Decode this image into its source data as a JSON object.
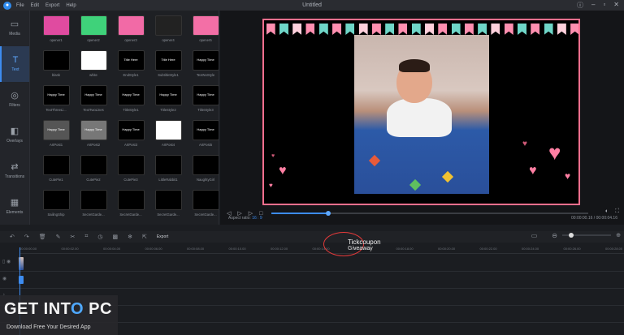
{
  "window": {
    "title": "Untitled",
    "menu": [
      "File",
      "Edit",
      "Export",
      "Help"
    ]
  },
  "sidebar": [
    {
      "label": "Media",
      "icon": "media-icon",
      "glyph": "▭",
      "active": false
    },
    {
      "label": "Text",
      "icon": "text-icon",
      "glyph": "T",
      "active": true
    },
    {
      "label": "Filters",
      "icon": "filters-icon",
      "glyph": "◎",
      "active": false
    },
    {
      "label": "Overlays",
      "icon": "overlays-icon",
      "glyph": "◧",
      "active": false
    },
    {
      "label": "Transitions",
      "icon": "transitions-icon",
      "glyph": "⇄",
      "active": false
    },
    {
      "label": "Elements",
      "icon": "elements-icon",
      "glyph": "▦",
      "active": false
    }
  ],
  "library": {
    "items": [
      {
        "label": "opener1",
        "bg": "#e04ba0",
        "text": ""
      },
      {
        "label": "opener2",
        "bg": "#3fd27a",
        "text": ""
      },
      {
        "label": "opener3",
        "bg": "#f26aa6",
        "text": ""
      },
      {
        "label": "opener4",
        "bg": "#222",
        "text": ""
      },
      {
        "label": "opener5",
        "bg": "#f36fa6",
        "text": ""
      },
      {
        "label": "blank",
        "bg": "#000",
        "text": ""
      },
      {
        "label": "white",
        "bg": "#fff",
        "text": ""
      },
      {
        "label": "EndStyle1",
        "bg": "#000",
        "text": "Title Here"
      },
      {
        "label": "SubtitleStyle1",
        "bg": "#000",
        "text": "Title Here"
      },
      {
        "label": "TextNoStyle",
        "bg": "#000",
        "text": "Happy Time"
      },
      {
        "label": "TextThreeLi...",
        "bg": "#000",
        "text": "Happy Time"
      },
      {
        "label": "TextTwoLines",
        "bg": "#000",
        "text": "Happy Time"
      },
      {
        "label": "TitleStyle1",
        "bg": "#000",
        "text": "Happy Time"
      },
      {
        "label": "TitleStyle2",
        "bg": "#000",
        "text": "Happy Time"
      },
      {
        "label": "TitleStyle3",
        "bg": "#000",
        "text": "Happy Time"
      },
      {
        "label": "ArtPost1",
        "bg": "#555",
        "text": "Happy Time"
      },
      {
        "label": "ArtPost2",
        "bg": "#777",
        "text": "Happy Time"
      },
      {
        "label": "ArtPost3",
        "bg": "#000",
        "text": "Happy Time"
      },
      {
        "label": "ArtPost4",
        "bg": "#fff",
        "text": ""
      },
      {
        "label": "ArtPost5",
        "bg": "#000",
        "text": "Happy Time"
      },
      {
        "label": "CutePie1",
        "bg": "#000",
        "text": ""
      },
      {
        "label": "CutePie2",
        "bg": "#000",
        "text": ""
      },
      {
        "label": "CutePie3",
        "bg": "#000",
        "text": ""
      },
      {
        "label": "LittleRabbit1",
        "bg": "#000",
        "text": ""
      },
      {
        "label": "NaughtyGirl",
        "bg": "#000",
        "text": ""
      },
      {
        "label": "SailingShip",
        "bg": "#000",
        "text": ""
      },
      {
        "label": "SecretGarde...",
        "bg": "#000",
        "text": ""
      },
      {
        "label": "SecretGarde...",
        "bg": "#000",
        "text": ""
      },
      {
        "label": "SecretGarde...",
        "bg": "#000",
        "text": ""
      },
      {
        "label": "SecretGarde...",
        "bg": "#000",
        "text": ""
      }
    ]
  },
  "preview": {
    "aspect_label": "Aspect ratio:",
    "aspect_value": "16 : 9",
    "timecode": "00:00:00.16 / 00:00:04.16",
    "progress": 0.18
  },
  "timeline": {
    "export_label": "Export",
    "ruler": [
      "00:00:00.00",
      "00:00:02.00",
      "00:00:04.00",
      "00:00:06.00",
      "00:00:08.00",
      "00:00:10.00",
      "00:00:12.00",
      "00:00:14.00",
      "00:00:16.00",
      "00:00:18.00",
      "00:00:20.00",
      "00:00:22.00",
      "00:00:24.00",
      "00:00:26.00",
      "00:00:28.00"
    ]
  },
  "watermark": {
    "line1": "Tickcoupon",
    "line2": "Giveaway"
  },
  "badge": {
    "main_a": "GET INT",
    "main_o": "O",
    "main_b": " PC",
    "sub": "Download Free Your Desired App"
  },
  "colors": {
    "accent": "#3d8cf0",
    "frame": "#ff6f8e"
  }
}
